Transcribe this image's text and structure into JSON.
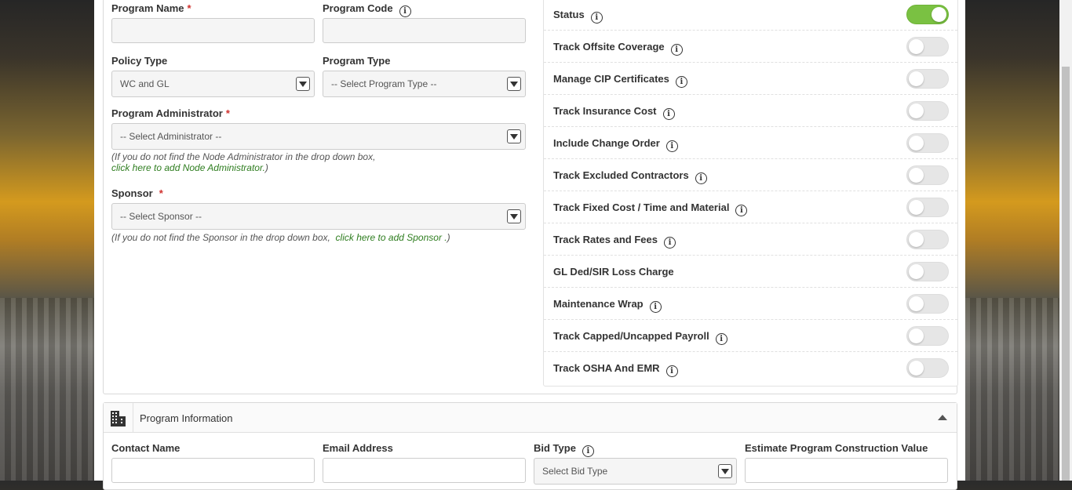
{
  "form": {
    "program_name_label": "Program Name",
    "program_code_label": "Program Code",
    "policy_type_label": "Policy Type",
    "policy_type_value": "WC and GL",
    "program_type_label": "Program Type",
    "program_type_value": "-- Select Program Type --",
    "program_admin_label": "Program Administrator",
    "program_admin_value": "-- Select Administrator --",
    "admin_hint": "(If you do not find the Node Administrator in the drop down box,",
    "admin_hint_link": "click here to add Node Administrator.",
    "admin_hint_close": ")",
    "sponsor_label": "Sponsor",
    "sponsor_value": "-- Select Sponsor --",
    "sponsor_hint": "(If you do not find the Sponsor in the drop down box,",
    "sponsor_hint_link": "click here to add Sponsor .",
    "sponsor_hint_close": ")",
    "required_mark": "*",
    "info_glyph": "i"
  },
  "toggles": [
    {
      "label": "Status",
      "on": true,
      "info": true
    },
    {
      "label": "Track Offsite Coverage",
      "on": false,
      "info": true
    },
    {
      "label": "Manage CIP Certificates",
      "on": false,
      "info": true
    },
    {
      "label": "Track Insurance Cost",
      "on": false,
      "info": true
    },
    {
      "label": "Include Change Order",
      "on": false,
      "info": true
    },
    {
      "label": "Track Excluded Contractors",
      "on": false,
      "info": true
    },
    {
      "label": "Track Fixed Cost / Time and Material",
      "on": false,
      "info": true
    },
    {
      "label": "Track Rates and Fees",
      "on": false,
      "info": true
    },
    {
      "label": "GL Ded/SIR Loss Charge",
      "on": false,
      "info": false
    },
    {
      "label": "Maintenance Wrap",
      "on": false,
      "info": true
    },
    {
      "label": "Track Capped/Uncapped Payroll",
      "on": false,
      "info": true
    },
    {
      "label": "Track OSHA And EMR",
      "on": false,
      "info": true
    }
  ],
  "program_info": {
    "title": "Program Information",
    "contact_name_label": "Contact Name",
    "email_label": "Email Address",
    "bid_type_label": "Bid Type",
    "bid_type_value": "Select Bid Type",
    "estimate_label": "Estimate Program Construction Value"
  },
  "colors": {
    "toggle_on": "#7ac142",
    "toggle_off": "#e6e6e6",
    "link": "#2e7d1f",
    "required": "#d0312d"
  }
}
